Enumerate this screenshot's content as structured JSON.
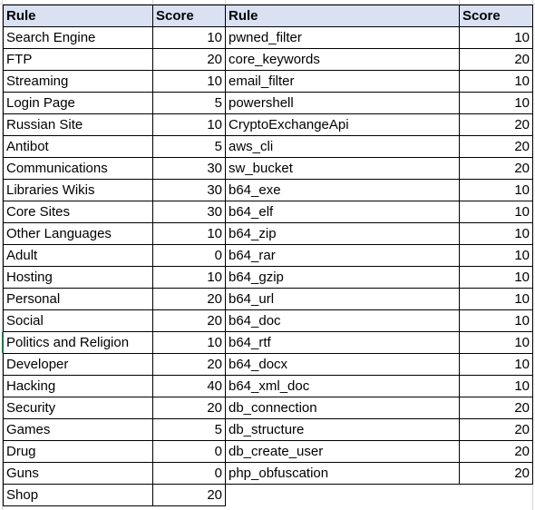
{
  "left_table": {
    "headers": {
      "rule": "Rule",
      "score": "Score"
    },
    "rows": [
      {
        "rule": "Search Engine",
        "score": "10"
      },
      {
        "rule": "FTP",
        "score": "20"
      },
      {
        "rule": "Streaming",
        "score": "10"
      },
      {
        "rule": "Login Page",
        "score": "5"
      },
      {
        "rule": "Russian Site",
        "score": "10"
      },
      {
        "rule": "Antibot",
        "score": "5"
      },
      {
        "rule": "Communications",
        "score": "30"
      },
      {
        "rule": "Libraries Wikis",
        "score": "30"
      },
      {
        "rule": "Core Sites",
        "score": "30"
      },
      {
        "rule": "Other Languages",
        "score": "10"
      },
      {
        "rule": "Adult",
        "score": "0"
      },
      {
        "rule": "Hosting",
        "score": "10"
      },
      {
        "rule": "Personal",
        "score": "20"
      },
      {
        "rule": "Social",
        "score": "20"
      },
      {
        "rule": "Politics and Religion",
        "score": "10"
      },
      {
        "rule": "Developer",
        "score": "20"
      },
      {
        "rule": "Hacking",
        "score": "40"
      },
      {
        "rule": "Security",
        "score": "20"
      },
      {
        "rule": "Games",
        "score": "5"
      },
      {
        "rule": "Drug",
        "score": "0"
      },
      {
        "rule": "Guns",
        "score": "0"
      },
      {
        "rule": "Shop",
        "score": "20"
      }
    ]
  },
  "right_table": {
    "headers": {
      "rule": "Rule",
      "score": "Score"
    },
    "rows": [
      {
        "rule": "pwned_filter",
        "score": "10"
      },
      {
        "rule": "core_keywords",
        "score": "20"
      },
      {
        "rule": "email_filter",
        "score": "10"
      },
      {
        "rule": "powershell",
        "score": "10"
      },
      {
        "rule": "CryptoExchangeApi",
        "score": "20"
      },
      {
        "rule": "aws_cli",
        "score": "20"
      },
      {
        "rule": "sw_bucket",
        "score": "20"
      },
      {
        "rule": "b64_exe",
        "score": "10"
      },
      {
        "rule": "b64_elf",
        "score": "10"
      },
      {
        "rule": "b64_zip",
        "score": "10"
      },
      {
        "rule": "b64_rar",
        "score": "10"
      },
      {
        "rule": "b64_gzip",
        "score": "10"
      },
      {
        "rule": "b64_url",
        "score": "10"
      },
      {
        "rule": "b64_doc",
        "score": "10"
      },
      {
        "rule": "b64_rtf",
        "score": "10"
      },
      {
        "rule": "b64_docx",
        "score": "10"
      },
      {
        "rule": "b64_xml_doc",
        "score": "10"
      },
      {
        "rule": "db_connection",
        "score": "20"
      },
      {
        "rule": "db_structure",
        "score": "20"
      },
      {
        "rule": "db_create_user",
        "score": "20"
      },
      {
        "rule": "php_obfuscation",
        "score": "20"
      }
    ]
  },
  "colors": {
    "header_background": "#d9e1f2",
    "border": "#000000",
    "gridline": "#d4d4d4",
    "selection": "#217346"
  }
}
